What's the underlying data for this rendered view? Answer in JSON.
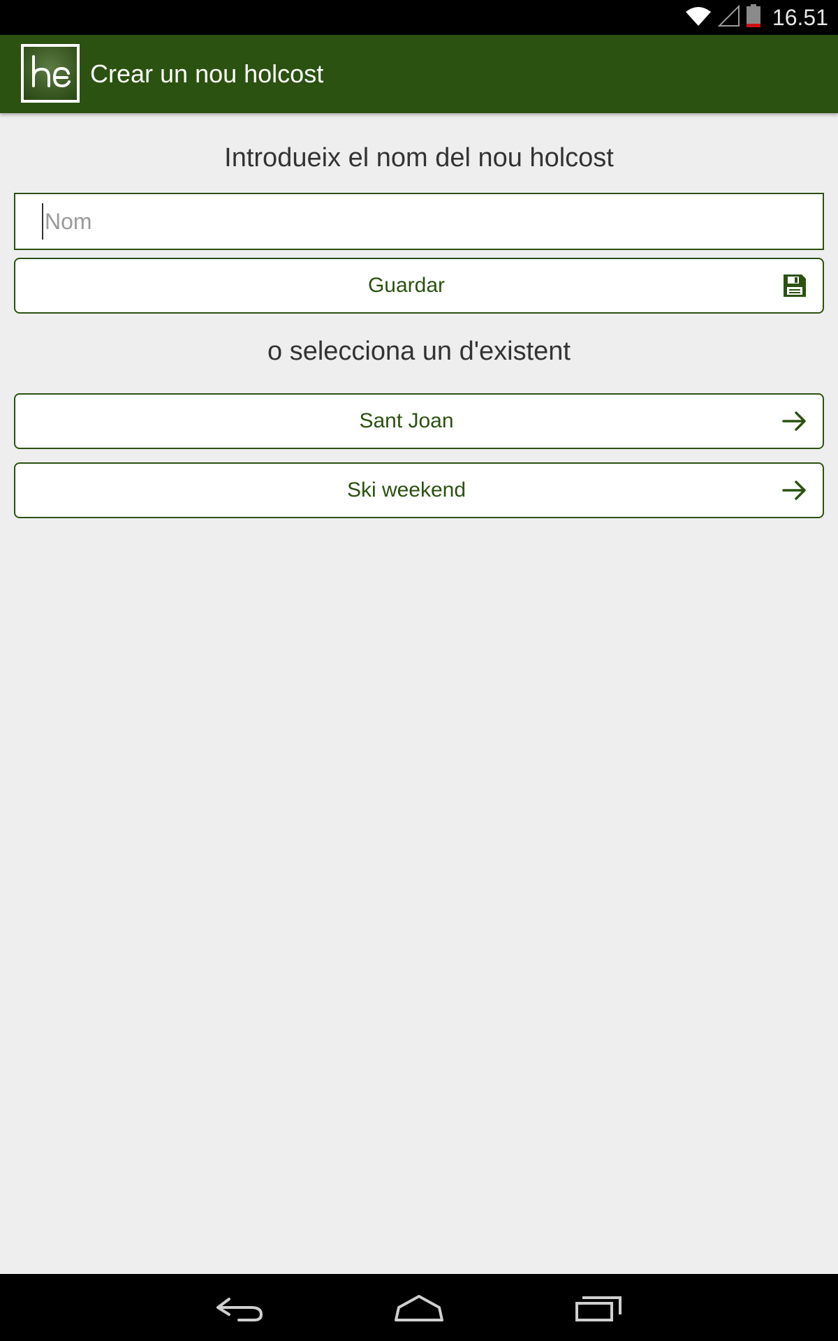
{
  "status_bar": {
    "time": "16.51",
    "icons": [
      "wifi-icon",
      "signal-icon",
      "battery-icon"
    ]
  },
  "app_bar": {
    "logo_icon": "holcost-logo",
    "title": "Crear un nou holcost"
  },
  "main": {
    "new_heading": "Introdueix el nom del nou holcost",
    "name_input": {
      "value": "",
      "placeholder": "Nom"
    },
    "save_button": {
      "label": "Guardar",
      "icon": "floppy-disk-icon"
    },
    "existing_heading": "o selecciona un d'existent",
    "existing_items": [
      {
        "label": "Sant Joan",
        "icon": "arrow-right-icon"
      },
      {
        "label": "Ski weekend",
        "icon": "arrow-right-icon"
      }
    ]
  },
  "nav_bar": {
    "buttons": [
      "back-icon",
      "home-icon",
      "recents-icon"
    ]
  },
  "colors": {
    "primary": "#2b5210",
    "background": "#eeeeee",
    "text": "#333333",
    "placeholder": "#9a9a9a"
  }
}
